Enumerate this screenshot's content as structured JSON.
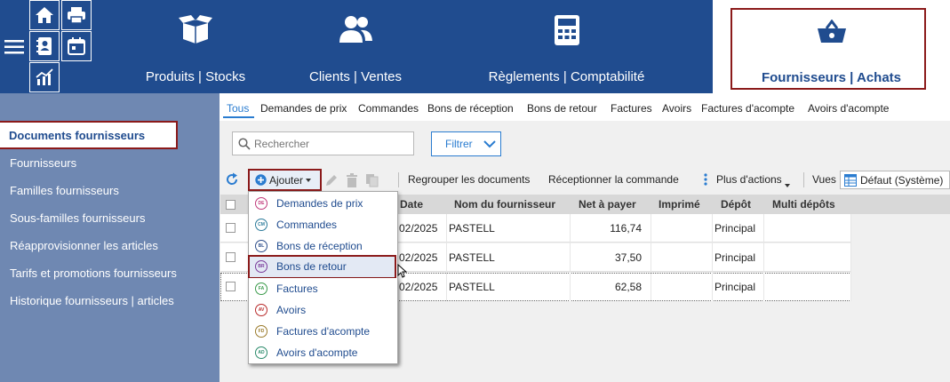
{
  "top_modules": [
    {
      "label": "Produits | Stocks",
      "icon": "box-icon"
    },
    {
      "label": "Clients | Ventes",
      "icon": "users-icon"
    },
    {
      "label": "Règlements | Comptabilité",
      "icon": "calculator-icon"
    },
    {
      "label": "Fournisseurs | Achats",
      "icon": "basket-icon",
      "active": true
    }
  ],
  "sidebar": {
    "active_label": "Documents fournisseurs",
    "items": [
      "Fournisseurs",
      "Familles fournisseurs",
      "Sous-familles fournisseurs",
      "Réapprovisionner les articles",
      "Tarifs et promotions fournisseurs",
      "Historique fournisseurs | articles"
    ]
  },
  "tabs": [
    "Tous",
    "Demandes de prix",
    "Commandes",
    "Bons de réception",
    "Bons de retour",
    "Factures",
    "Avoirs",
    "Factures d'acompte",
    "Avoirs d'acompte"
  ],
  "search": {
    "placeholder": "Rechercher"
  },
  "filter_label": "Filtrer",
  "toolbar": {
    "add_label": "Ajouter",
    "group_label": "Regrouper les documents",
    "receive_label": "Réceptionner la commande",
    "more_label": "Plus d'actions",
    "views_label": "Vues",
    "view_value": "Défaut (Système)"
  },
  "table": {
    "headers": [
      "Date",
      "Nom du fournisseur",
      "Net à payer",
      "Imprimé",
      "Dépôt",
      "Multi dépôts"
    ],
    "rows": [
      {
        "date": "02/2025",
        "supplier": "PASTELL",
        "net": "116,74",
        "depot": "Principal"
      },
      {
        "date": "02/2025",
        "supplier": "PASTELL",
        "net": "37,50",
        "depot": "Principal"
      },
      {
        "date": "02/2025",
        "supplier": "PASTELL",
        "net": "62,58",
        "depot": "Principal"
      }
    ]
  },
  "dropdown": {
    "items": [
      {
        "code": "DE",
        "label": "Demandes de prix",
        "color": "#c0397a"
      },
      {
        "code": "CM",
        "label": "Commandes",
        "color": "#2b7a9a"
      },
      {
        "code": "BL",
        "label": "Bons de réception",
        "color": "#2d4e8a"
      },
      {
        "code": "BR",
        "label": "Bons de retour",
        "color": "#7a3a9a"
      },
      {
        "code": "FA",
        "label": "Factures",
        "color": "#3a9a4a"
      },
      {
        "code": "AV",
        "label": "Avoirs",
        "color": "#b82a2a"
      },
      {
        "code": "FD",
        "label": "Factures d'acompte",
        "color": "#9a7a2a"
      },
      {
        "code": "AD",
        "label": "Avoirs d'acompte",
        "color": "#2a8a6a"
      }
    ]
  }
}
